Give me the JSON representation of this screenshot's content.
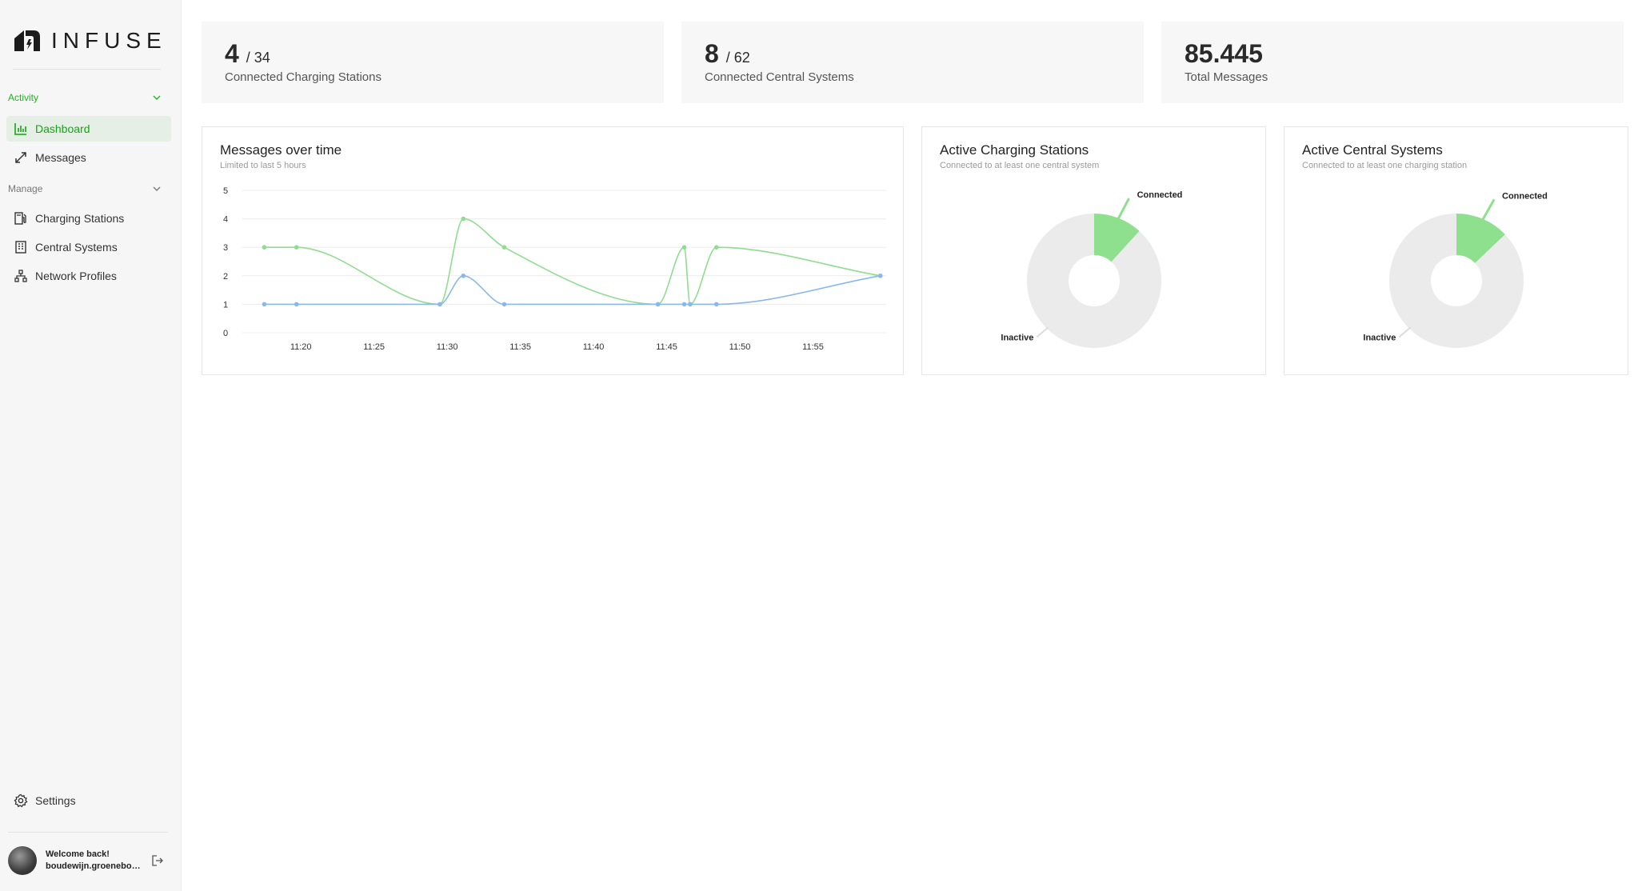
{
  "brand": {
    "name": "INFUSE"
  },
  "sidebar": {
    "sections": [
      {
        "label": "Activity",
        "items": [
          {
            "label": "Dashboard",
            "icon": "bar-chart-icon",
            "active": true
          },
          {
            "label": "Messages",
            "icon": "arrows-icon",
            "active": false
          }
        ]
      },
      {
        "label": "Manage",
        "items": [
          {
            "label": "Charging Stations",
            "icon": "charging-station-icon"
          },
          {
            "label": "Central Systems",
            "icon": "building-icon"
          },
          {
            "label": "Network Profiles",
            "icon": "network-icon"
          }
        ]
      }
    ],
    "settings_label": "Settings",
    "user": {
      "greeting": "Welcome back!",
      "email": "boudewijn.groeneboer..."
    }
  },
  "stats": [
    {
      "value": "4",
      "suffix": "/ 34",
      "label": "Connected Charging Stations"
    },
    {
      "value": "8",
      "suffix": "/ 62",
      "label": "Connected Central Systems"
    },
    {
      "value": "85.445",
      "suffix": "",
      "label": "Total Messages"
    }
  ],
  "messages_card": {
    "title": "Messages over time",
    "subtitle": "Limited to last 5 hours"
  },
  "stations_card": {
    "title": "Active Charging Stations",
    "subtitle": "Connected to at least one central system"
  },
  "systems_card": {
    "title": "Active Central Systems",
    "subtitle": "Connected to at least one charging station"
  },
  "colors": {
    "accent": "#1db31d",
    "green_series": "#8fdd8f",
    "blue_series": "#8ab8ec",
    "pie_inactive": "#ebebeb",
    "pie_connected": "#8ee08e"
  },
  "chart_data": [
    {
      "type": "line",
      "title": "Messages over time",
      "subtitle": "Limited to last 5 hours",
      "xlim": [
        "11:16",
        "11:60"
      ],
      "ylim": [
        0,
        5
      ],
      "y_ticks": [
        0,
        1,
        2,
        3,
        4,
        5
      ],
      "x_ticks": [
        "11:20",
        "11:25",
        "11:30",
        "11:35",
        "11:40",
        "11:45",
        "11:50",
        "11:55"
      ],
      "grid": true,
      "series": [
        {
          "color": "#8fdd8f",
          "points": [
            [
              17.5,
              3
            ],
            [
              19.7,
              3
            ],
            [
              29.5,
              1
            ],
            [
              31.1,
              4
            ],
            [
              33.9,
              3
            ],
            [
              44.4,
              1
            ],
            [
              46.2,
              3
            ],
            [
              46.6,
              1
            ],
            [
              48.4,
              3
            ],
            [
              59.6,
              2
            ]
          ]
        },
        {
          "color": "#8ab8ec",
          "points": [
            [
              17.5,
              1
            ],
            [
              19.7,
              1
            ],
            [
              29.5,
              1
            ],
            [
              31.1,
              2
            ],
            [
              33.9,
              1
            ],
            [
              44.4,
              1
            ],
            [
              46.2,
              1
            ],
            [
              46.6,
              1
            ],
            [
              48.4,
              1
            ],
            [
              59.6,
              2
            ]
          ]
        }
      ]
    },
    {
      "type": "pie",
      "title": "Active Charging Stations",
      "subtitle": "Connected to at least one central system",
      "labels": [
        "Connected",
        "Inactive"
      ],
      "values": [
        4,
        30
      ]
    },
    {
      "type": "pie",
      "title": "Active Central Systems",
      "subtitle": "Connected to at least one charging station",
      "labels": [
        "Connected",
        "Inactive"
      ],
      "values": [
        8,
        54
      ]
    }
  ]
}
